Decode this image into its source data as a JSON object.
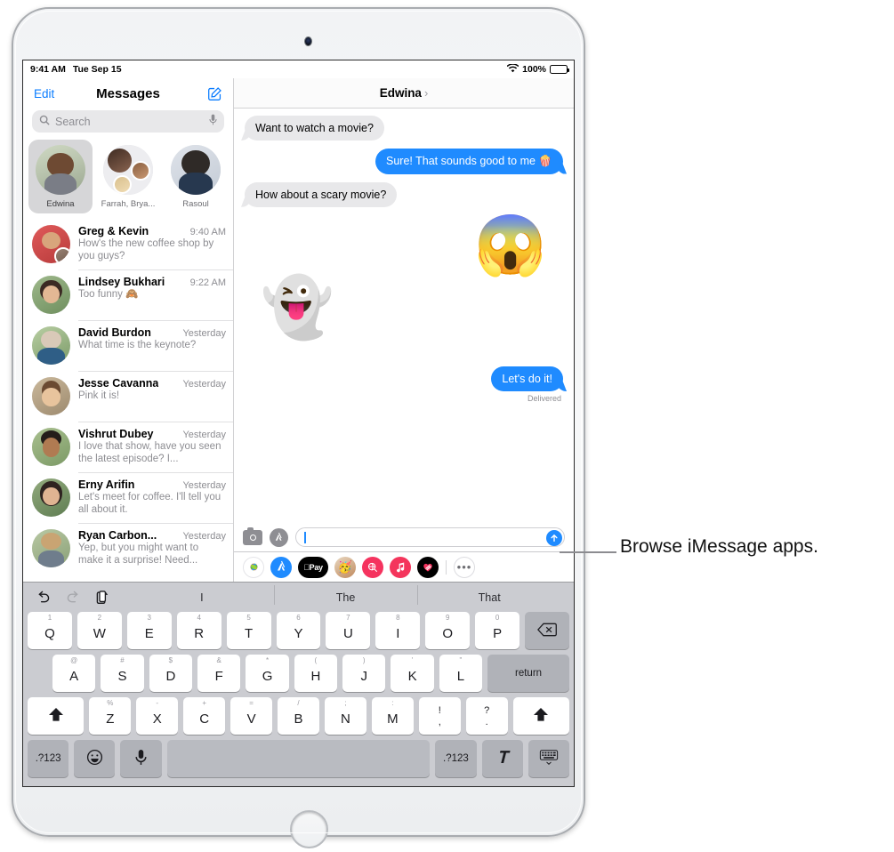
{
  "status_bar": {
    "time": "9:41 AM",
    "date": "Tue Sep 15",
    "wifi_icon": "wifi-icon",
    "battery_percent": "100%"
  },
  "sidebar": {
    "edit_label": "Edit",
    "title": "Messages",
    "compose_icon": "compose-icon",
    "search": {
      "icon": "search-icon",
      "placeholder": "Search",
      "mic_icon": "microphone-icon"
    },
    "pinned": [
      {
        "label": "Edwina",
        "selected": true
      },
      {
        "label": "Farrah, Brya...",
        "selected": false
      },
      {
        "label": "Rasoul",
        "selected": false
      }
    ],
    "conversations": [
      {
        "name": "Greg & Kevin",
        "time": "9:40 AM",
        "preview": "How's the new coffee shop by you guys?"
      },
      {
        "name": "Lindsey Bukhari",
        "time": "9:22 AM",
        "preview": "Too funny 🙈"
      },
      {
        "name": "David Burdon",
        "time": "Yesterday",
        "preview": "What time is the keynote?"
      },
      {
        "name": "Jesse Cavanna",
        "time": "Yesterday",
        "preview": "Pink it is!"
      },
      {
        "name": "Vishrut Dubey",
        "time": "Yesterday",
        "preview": "I love that show, have you seen the latest episode? I..."
      },
      {
        "name": "Erny Arifin",
        "time": "Yesterday",
        "preview": "Let's meet for coffee. I'll tell you all about it."
      },
      {
        "name": "Ryan Carbon...",
        "time": "Yesterday",
        "preview": "Yep, but you might want to make it a surprise! Need..."
      }
    ]
  },
  "conversation": {
    "header_name": "Edwina",
    "header_chevron_icon": "chevron-right-icon",
    "messages": [
      {
        "kind": "bubble",
        "direction": "in",
        "text": "Want to watch a movie?"
      },
      {
        "kind": "bubble",
        "direction": "out",
        "text": "Sure! That sounds good to me 🍿"
      },
      {
        "kind": "bubble",
        "direction": "in",
        "text": "How about a scary movie?"
      },
      {
        "kind": "sticker",
        "direction": "out",
        "text": "😱",
        "name": "memoji-shocked-sticker"
      },
      {
        "kind": "sticker",
        "direction": "in",
        "text": "👻",
        "name": "memoji-ghost-sticker"
      },
      {
        "kind": "bubble",
        "direction": "out",
        "text": "Let's do it!",
        "status": "Delivered"
      }
    ],
    "input": {
      "camera_icon": "camera-icon",
      "apps_icon": "app-store-icon",
      "placeholder": "",
      "value": "",
      "send_icon": "send-arrow-icon"
    },
    "app_drawer": [
      {
        "name": "photos-app-icon",
        "label": "Photos",
        "selected": false
      },
      {
        "name": "app-store-app-icon",
        "label": "App Store",
        "selected": true
      },
      {
        "name": "apple-pay-app-icon",
        "label": "Apple Pay",
        "selected": false
      },
      {
        "name": "memoji-stickers-app-icon",
        "label": "Memoji Stickers",
        "selected": false
      },
      {
        "name": "image-search-app-icon",
        "label": "#images",
        "selected": false
      },
      {
        "name": "music-app-icon",
        "label": "Music",
        "selected": false
      },
      {
        "name": "digital-touch-app-icon",
        "label": "Digital Touch",
        "selected": false
      }
    ],
    "more_apps_label": "•••"
  },
  "keyboard": {
    "tools": [
      {
        "name": "undo-icon",
        "disabled": false
      },
      {
        "name": "redo-icon",
        "disabled": true
      },
      {
        "name": "paste-icon",
        "disabled": false
      }
    ],
    "suggestions": [
      "I",
      "The",
      "That"
    ],
    "row1": [
      {
        "alt": "1",
        "main": "Q"
      },
      {
        "alt": "2",
        "main": "W"
      },
      {
        "alt": "3",
        "main": "E"
      },
      {
        "alt": "4",
        "main": "R"
      },
      {
        "alt": "5",
        "main": "T"
      },
      {
        "alt": "6",
        "main": "Y"
      },
      {
        "alt": "7",
        "main": "U"
      },
      {
        "alt": "8",
        "main": "I"
      },
      {
        "alt": "9",
        "main": "O"
      },
      {
        "alt": "0",
        "main": "P"
      }
    ],
    "backspace_icon": "backspace-icon",
    "row2": [
      {
        "alt": "@",
        "main": "A"
      },
      {
        "alt": "#",
        "main": "S"
      },
      {
        "alt": "$",
        "main": "D"
      },
      {
        "alt": "&",
        "main": "F"
      },
      {
        "alt": "*",
        "main": "G"
      },
      {
        "alt": "(",
        "main": "H"
      },
      {
        "alt": ")",
        "main": "J"
      },
      {
        "alt": "'",
        "main": "K"
      },
      {
        "alt": "\"",
        "main": "L"
      }
    ],
    "return_label": "return",
    "row3": [
      {
        "alt": "%",
        "main": "Z"
      },
      {
        "alt": "-",
        "main": "X"
      },
      {
        "alt": "+",
        "main": "C"
      },
      {
        "alt": "=",
        "main": "V"
      },
      {
        "alt": "/",
        "main": "B"
      },
      {
        "alt": ";",
        "main": "N"
      },
      {
        "alt": ":",
        "main": "M"
      }
    ],
    "punct_keys": [
      {
        "up": "!",
        "dn": ","
      },
      {
        "up": "?",
        "dn": "."
      }
    ],
    "shift_icon": "shift-icon",
    "row4": {
      "numbers_left": ".?123",
      "emoji_icon": "emoji-icon",
      "dictation_icon": "microphone-icon",
      "space_label": "",
      "numbers_right": ".?123",
      "handwriting_icon": "handwriting-icon",
      "dismiss_icon": "hide-keyboard-icon"
    }
  },
  "callout": {
    "text": "Browse iMessage apps."
  },
  "colors": {
    "accent_blue": "#0a7cff",
    "bubble_out": "#1f8bff",
    "bubble_in": "#e8e8ea",
    "keyboard_bg": "#cbccd1"
  }
}
